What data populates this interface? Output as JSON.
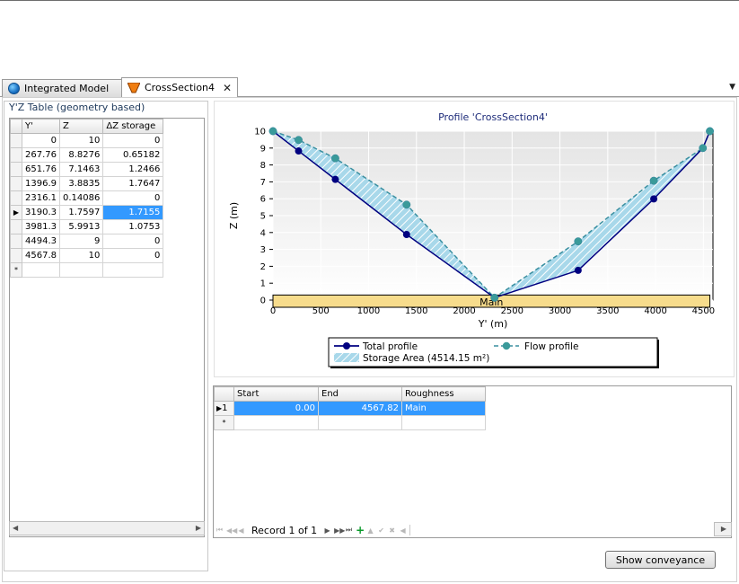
{
  "tabs": [
    {
      "label": "Integrated Model",
      "icon": "globe-icon"
    },
    {
      "label": "CrossSection4",
      "icon": "cross-section-icon",
      "close": "✕"
    }
  ],
  "left": {
    "title": "Y'Z Table (geometry based)",
    "columns": [
      "Y'",
      "Z",
      "ΔZ storage"
    ],
    "rows": [
      [
        "0",
        "10",
        "0"
      ],
      [
        "267.76",
        "8.8276",
        "0.65182"
      ],
      [
        "651.76",
        "7.1463",
        "1.2466"
      ],
      [
        "1396.9",
        "3.8835",
        "1.7647"
      ],
      [
        "2316.1",
        "0.14086",
        "0"
      ],
      [
        "3190.3",
        "1.7597",
        "1.7155"
      ],
      [
        "3981.3",
        "5.9913",
        "1.0753"
      ],
      [
        "4494.3",
        "9",
        "0"
      ],
      [
        "4567.8",
        "10",
        "0"
      ]
    ],
    "new_row_marker": "*",
    "current_row_marker": "▶"
  },
  "chart_data": {
    "type": "line",
    "title": "Profile 'CrossSection4'",
    "xlabel": "Y' (m)",
    "ylabel": "Z (m)",
    "xlim": [
      0,
      4600
    ],
    "ylim": [
      0,
      10
    ],
    "xticks": [
      0,
      500,
      1000,
      1500,
      2000,
      2500,
      3000,
      3500,
      4000,
      4500
    ],
    "yticks": [
      0,
      1,
      2,
      3,
      4,
      5,
      6,
      7,
      8,
      9,
      10
    ],
    "grid": true,
    "series": [
      {
        "name": "Total profile",
        "color": "#000080",
        "x": [
          0,
          267.76,
          651.76,
          1396.9,
          2316.1,
          3190.3,
          3981.3,
          4494.3,
          4567.8
        ],
        "y": [
          10,
          8.8276,
          7.1463,
          3.8835,
          0.14086,
          1.7597,
          5.9913,
          9,
          10
        ]
      },
      {
        "name": "Flow profile",
        "color": "#3a8fa0",
        "x": [
          0,
          267.76,
          651.76,
          1396.9,
          2316.1,
          3190.3,
          3981.3,
          4494.3,
          4567.8
        ],
        "y": [
          10,
          9.47942,
          8.3929,
          5.6482,
          0.14086,
          3.4752,
          7.0666,
          9,
          10
        ]
      }
    ],
    "storage_area_label": "Storage Area (4514.15 m²)",
    "section": {
      "label": "Main",
      "start": 0,
      "end": 4567.82,
      "top": 0.3,
      "color": "#f7dc8c"
    }
  },
  "bottom": {
    "columns": [
      "Start",
      "End",
      "Roughness"
    ],
    "rows": [
      [
        "0.00",
        "4567.82",
        "Main"
      ]
    ],
    "row_number": "1",
    "new_row_marker": "*",
    "record_label": "Record 1 of 1"
  },
  "show_conveyance_label": "Show conveyance",
  "colors": {
    "accent": "#3399ff",
    "storage_fill": "#a8d8ea",
    "section_fill": "#f7dc8c"
  }
}
